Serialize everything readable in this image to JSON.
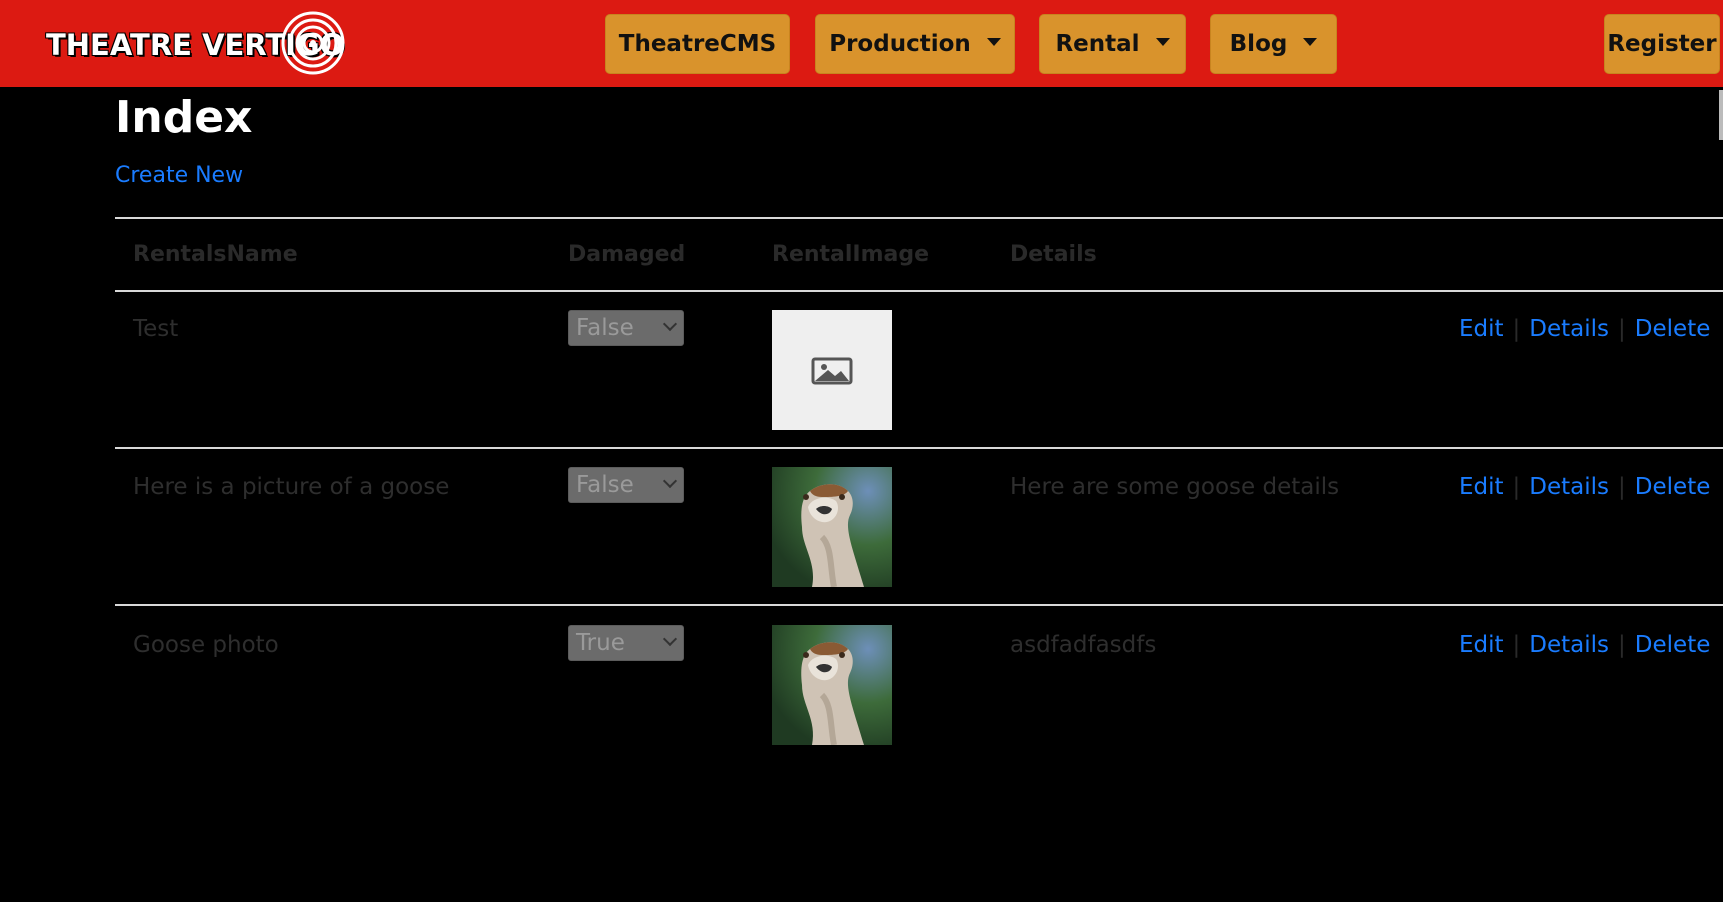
{
  "brand": {
    "logo_text": "THEATRE VERTIGO"
  },
  "nav": {
    "items": [
      {
        "label": "TheatreCMS",
        "dropdown": false
      },
      {
        "label": "Production",
        "dropdown": true
      },
      {
        "label": "Rental",
        "dropdown": true
      },
      {
        "label": "Blog",
        "dropdown": true
      }
    ],
    "register_label": "Register"
  },
  "page": {
    "title": "Index",
    "create_link": "Create New"
  },
  "table": {
    "headers": [
      "RentalsName",
      "Damaged",
      "RentalImage",
      "Details"
    ],
    "rows": [
      {
        "name": "Test",
        "damaged": "False",
        "image": "placeholder",
        "details": ""
      },
      {
        "name": "Here is a picture of a goose",
        "damaged": "False",
        "image": "goose",
        "details": "Here are some goose details"
      },
      {
        "name": "Goose photo",
        "damaged": "True",
        "image": "goose",
        "details": "asdfadfasdfs"
      }
    ],
    "actions": [
      "Edit",
      "Details",
      "Delete"
    ]
  },
  "colors": {
    "navbar": "#dc1a12",
    "nav_button": "#d9932c",
    "link": "#1a7cff",
    "background": "#000000"
  }
}
